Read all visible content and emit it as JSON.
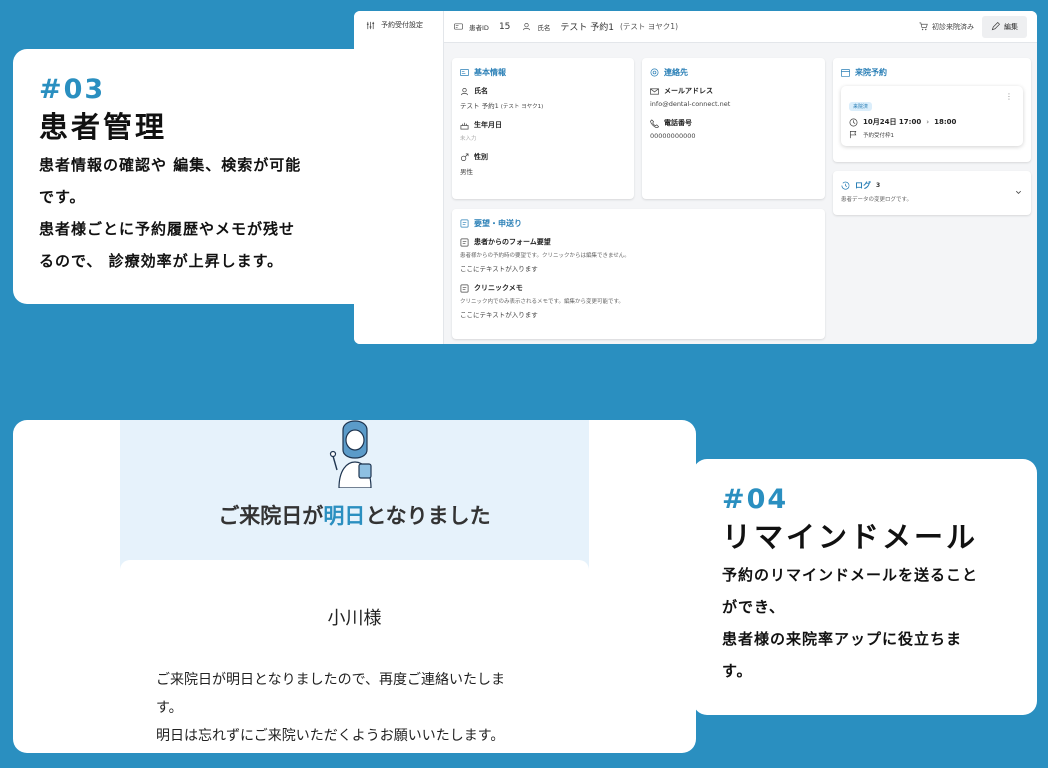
{
  "colors": {
    "background": "#2a8fc0",
    "accent": "#2a8fc0",
    "app_accent": "#2a7fb6",
    "hero_bg": "#e6f2fb"
  },
  "feature03": {
    "number": "#03",
    "title": "患者管理",
    "desc": [
      "患者情報の確認や 編集、検索が可能",
      "です。",
      "患者様ごとに予約履歴やメモが残せ",
      "るので、 診療効率が上昇します。"
    ]
  },
  "app": {
    "sidebar": {
      "item_label": "予約受付設定",
      "item_icon": "sliders-icon"
    },
    "header": {
      "patient_id_label": "患者ID",
      "patient_id": "15",
      "name_label": "氏名",
      "name": "テスト 予約1",
      "name_kana": "(テスト ヨヤク1)",
      "first_visit_button": "初診来院済み",
      "edit_button": "編集"
    },
    "basic": {
      "title": "基本情報",
      "name_label": "氏名",
      "name_value": "テスト 予約1",
      "name_kana": "(テスト ヨヤク1)",
      "birth_label": "生年月日",
      "birth_value": "未入力",
      "gender_label": "性別",
      "gender_value": "男性"
    },
    "contact": {
      "title": "連絡先",
      "email_label": "メールアドレス",
      "email_value": "info@dental-connect.net",
      "phone_label": "電話番号",
      "phone_value": "00000000000"
    },
    "visit": {
      "title": "来院予約",
      "badge": "来院済",
      "date": "10月24日 17:00",
      "arrow": "›",
      "end": "18:00",
      "slot": "予約受付枠1"
    },
    "log": {
      "title": "ログ",
      "count": "3",
      "desc": "患者データの変更ログです。"
    },
    "requests": {
      "title": "要望・申送り",
      "form_label": "患者からのフォーム要望",
      "form_note": "患者様からの予約時の要望です。クリニックからは編集できません。",
      "form_value": "ここにテキストが入ります",
      "memo_label": "クリニックメモ",
      "memo_note": "クリニック内でのみ表示されるメモです。編集から変更可能です。",
      "memo_value": "ここにテキストが入ります"
    }
  },
  "mail": {
    "hero_pre": "ご来院日が",
    "hero_hl": "明日",
    "hero_post": "となりました",
    "name": "小川様",
    "body": [
      "ご来院日が明日となりましたので、再度ご連絡いたしま",
      "す。",
      "明日は忘れずにご来院いただくようお願いいたします。"
    ]
  },
  "feature04": {
    "number": "#04",
    "title": "リマインドメール",
    "desc": [
      "予約のリマインドメールを送ること",
      "ができ、",
      "患者様の来院率アップに役立ちま",
      "す。"
    ]
  }
}
